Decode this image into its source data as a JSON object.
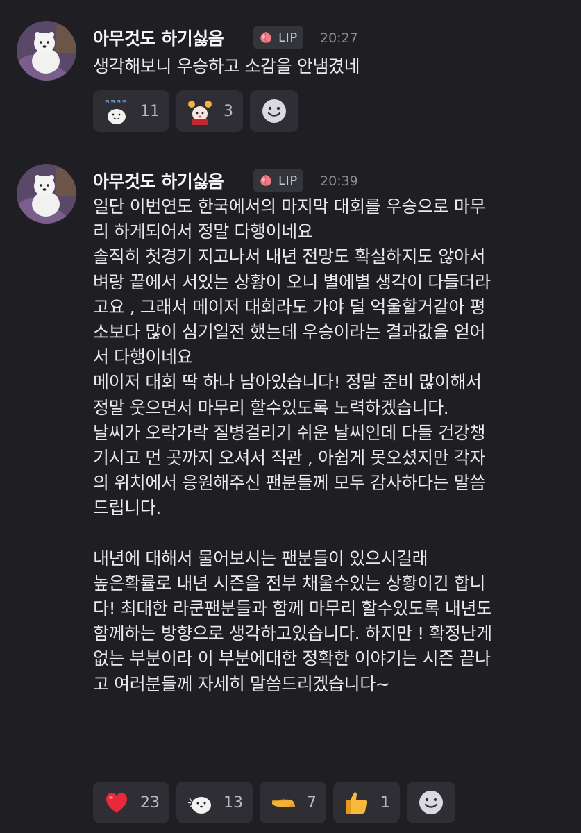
{
  "messages": [
    {
      "author": "아무것도 하기싫음",
      "badge": "LIP",
      "time": "20:27",
      "lines": [
        "생각해보니 우승하고 소감을 안냄겼네"
      ],
      "reactions": [
        {
          "icon": "bear-sticker-icon",
          "count": "11"
        },
        {
          "icon": "cheer-character-icon",
          "count": "3"
        }
      ]
    },
    {
      "author": "아무것도 하기싫음",
      "badge": "LIP",
      "time": "20:39",
      "lines": [
        "일단 이번연도 한국에서의 마지막 대회를 우승으로 마무",
        "리 하게되어서 정말 다행이네요",
        "솔직히 첫경기 지고나서 내년 전망도 확실하지도 않아서",
        "벼랑 끝에서 서있는 상황이 오니 별에별 생각이 다들더라",
        "고요 , 그래서 메이저 대회라도 가야 덜 억울할거같아 평",
        "소보다 많이 심기일전 했는데 우승이라는 결과값을 얻어",
        "서 다행이네요",
        "메이저 대회 딱 하나 남아있습니다! 정말 준비 많이해서",
        "정말 웃으면서 마무리 할수있도록 노력하겠습니다.",
        "날씨가 오락가락 질병걸리기 쉬운 날씨인데 다들 건강챙",
        "기시고 먼 곳까지 오셔서 직관 , 아쉽게 못오셨지만 각자",
        "의 위치에서 응원해주신 팬분들께 모두 감사하다는 말씀",
        "드립니다.",
        "",
        "내년에 대해서 물어보시는 팬분들이 있으시길래",
        "높은확률로 내년 시즌을 전부 채울수있는 상황이긴 합니",
        "다! 최대한 라쿤팬분들과 함께 마무리 할수있도록 내년도",
        "함께하는 방향으로 생각하고있습니다. 하지만 ! 확정난게",
        "없는 부분이라 이 부분에대한 정확한 이야기는 시즌 끝나",
        "고 여러분들께 자세히 말씀드리겠습니다~"
      ],
      "reactions": [
        {
          "icon": "red-heart-icon",
          "count": "23"
        },
        {
          "icon": "bear-sticker-icon",
          "count": "13"
        },
        {
          "icon": "pointing-hand-icon",
          "count": "7"
        },
        {
          "icon": "thumbs-up-icon",
          "count": "1"
        }
      ]
    }
  ]
}
